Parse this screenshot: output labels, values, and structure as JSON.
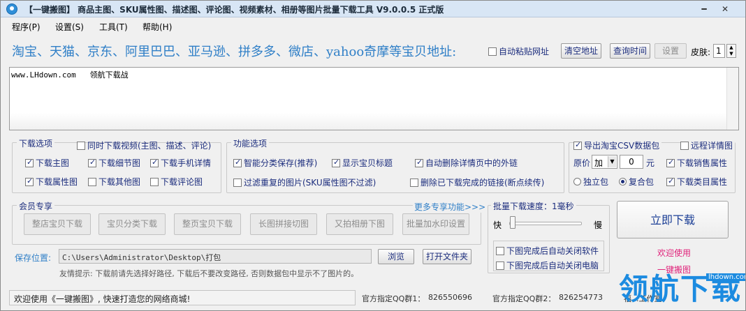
{
  "window": {
    "title": "【一键搬图】 商品主图、SKU属性图、描述图、评论图、视频素材、相册等图片批量下载工具 V9.0.0.5 正式版"
  },
  "menu": [
    {
      "label": "程序(P)"
    },
    {
      "label": "设置(S)"
    },
    {
      "label": "工具(T)"
    },
    {
      "label": "帮助(H)"
    }
  ],
  "banner": {
    "text": "淘宝、天猫、京东、阿里巴巴、亚马逊、拼多多、微店、yahoo奇摩等宝贝地址:",
    "auto_paste_label": "自动粘贴网址",
    "auto_paste_checked": false,
    "clear_button": "清空地址",
    "query_time_button": "查询时间",
    "settings_button": "设置",
    "skin_label": "皮肤:",
    "skin_value": "1"
  },
  "url_box": {
    "content": "www.LHdown.com   领航下载战"
  },
  "download_options": {
    "title": "下载选项",
    "video_label": "同时下载视频(主图、描述、评论)",
    "video_checked": false,
    "items": [
      {
        "label": "下载主图",
        "checked": true
      },
      {
        "label": "下载细节图",
        "checked": true
      },
      {
        "label": "下载手机详情",
        "checked": true
      },
      {
        "label": "下载属性图",
        "checked": true
      },
      {
        "label": "下载其他图",
        "checked": false
      },
      {
        "label": "下载评论图",
        "checked": false
      }
    ]
  },
  "function_options": {
    "title": "功能选项",
    "items": [
      {
        "label": "智能分类保存(推荐)",
        "checked": true
      },
      {
        "label": "显示宝贝标题",
        "checked": true
      },
      {
        "label": "自动删除详情页中的外链",
        "checked": true
      },
      {
        "label": "过滤重复的图片(SKU属性图不过滤)",
        "checked": false
      },
      {
        "label": "删除已下载完成的链接(断点续传)",
        "checked": false
      }
    ]
  },
  "export_options": {
    "export_csv_label": "导出淘宝CSV数据包",
    "export_csv_checked": true,
    "remote_detail_label": "远程详情图",
    "remote_detail_checked": false,
    "price_label": "原价",
    "price_op": "加",
    "price_value": "0",
    "price_unit": "元",
    "sales_attr_label": "下载销售属性",
    "sales_attr_checked": true,
    "single_pkg_label": "独立包",
    "single_pkg_checked": false,
    "combined_pkg_label": "复合包",
    "combined_pkg_checked": true,
    "category_attr_label": "下载类目属性",
    "category_attr_checked": true
  },
  "member": {
    "title": "会员专享",
    "more_link": "更多专享功能>>>",
    "buttons": [
      "整店宝贝下载",
      "宝贝分类下载",
      "整页宝贝下载",
      "长图拼接切图",
      "又拍相册下图",
      "批量加水印设置"
    ]
  },
  "speed": {
    "title": "批量下载速度：1毫秒",
    "fast_label": "快",
    "slow_label": "慢",
    "slider_fraction": 0.0,
    "close_app_label": "下图完成后自动关闭软件",
    "close_app_checked": false,
    "shutdown_label": "下图完成后自动关闭电脑",
    "shutdown_checked": false
  },
  "download_button": "立即下载",
  "welcome": {
    "line1": "欢迎使用",
    "line2": "一键搬图",
    "color": "#e0227a"
  },
  "save": {
    "label": "保存位置:",
    "path": "C:\\Users\\Administrator\\Desktop\\打包",
    "browse_button": "浏览",
    "open_folder_button": "打开文件夹",
    "tip": "友情提示: 下载前请先选择好路径, 下载后不要改变路径, 否则数据包中显示不了图片的。"
  },
  "status": {
    "welcome": "欢迎使用《一键搬图》, 快速打造您的网络商城!",
    "qq1_label": "官方指定QQ群1：",
    "qq1_value": "826550696",
    "qq2_label": "官方指定QQ群2：",
    "qq2_value": "826254773",
    "studio": "福...工作室"
  },
  "watermark": {
    "text": "领航下载",
    "site": "lhdown.com"
  },
  "colors": {
    "accent_blue": "#2f7fc7",
    "label_blue": "#1c2d7d",
    "pink": "#e0227a"
  }
}
